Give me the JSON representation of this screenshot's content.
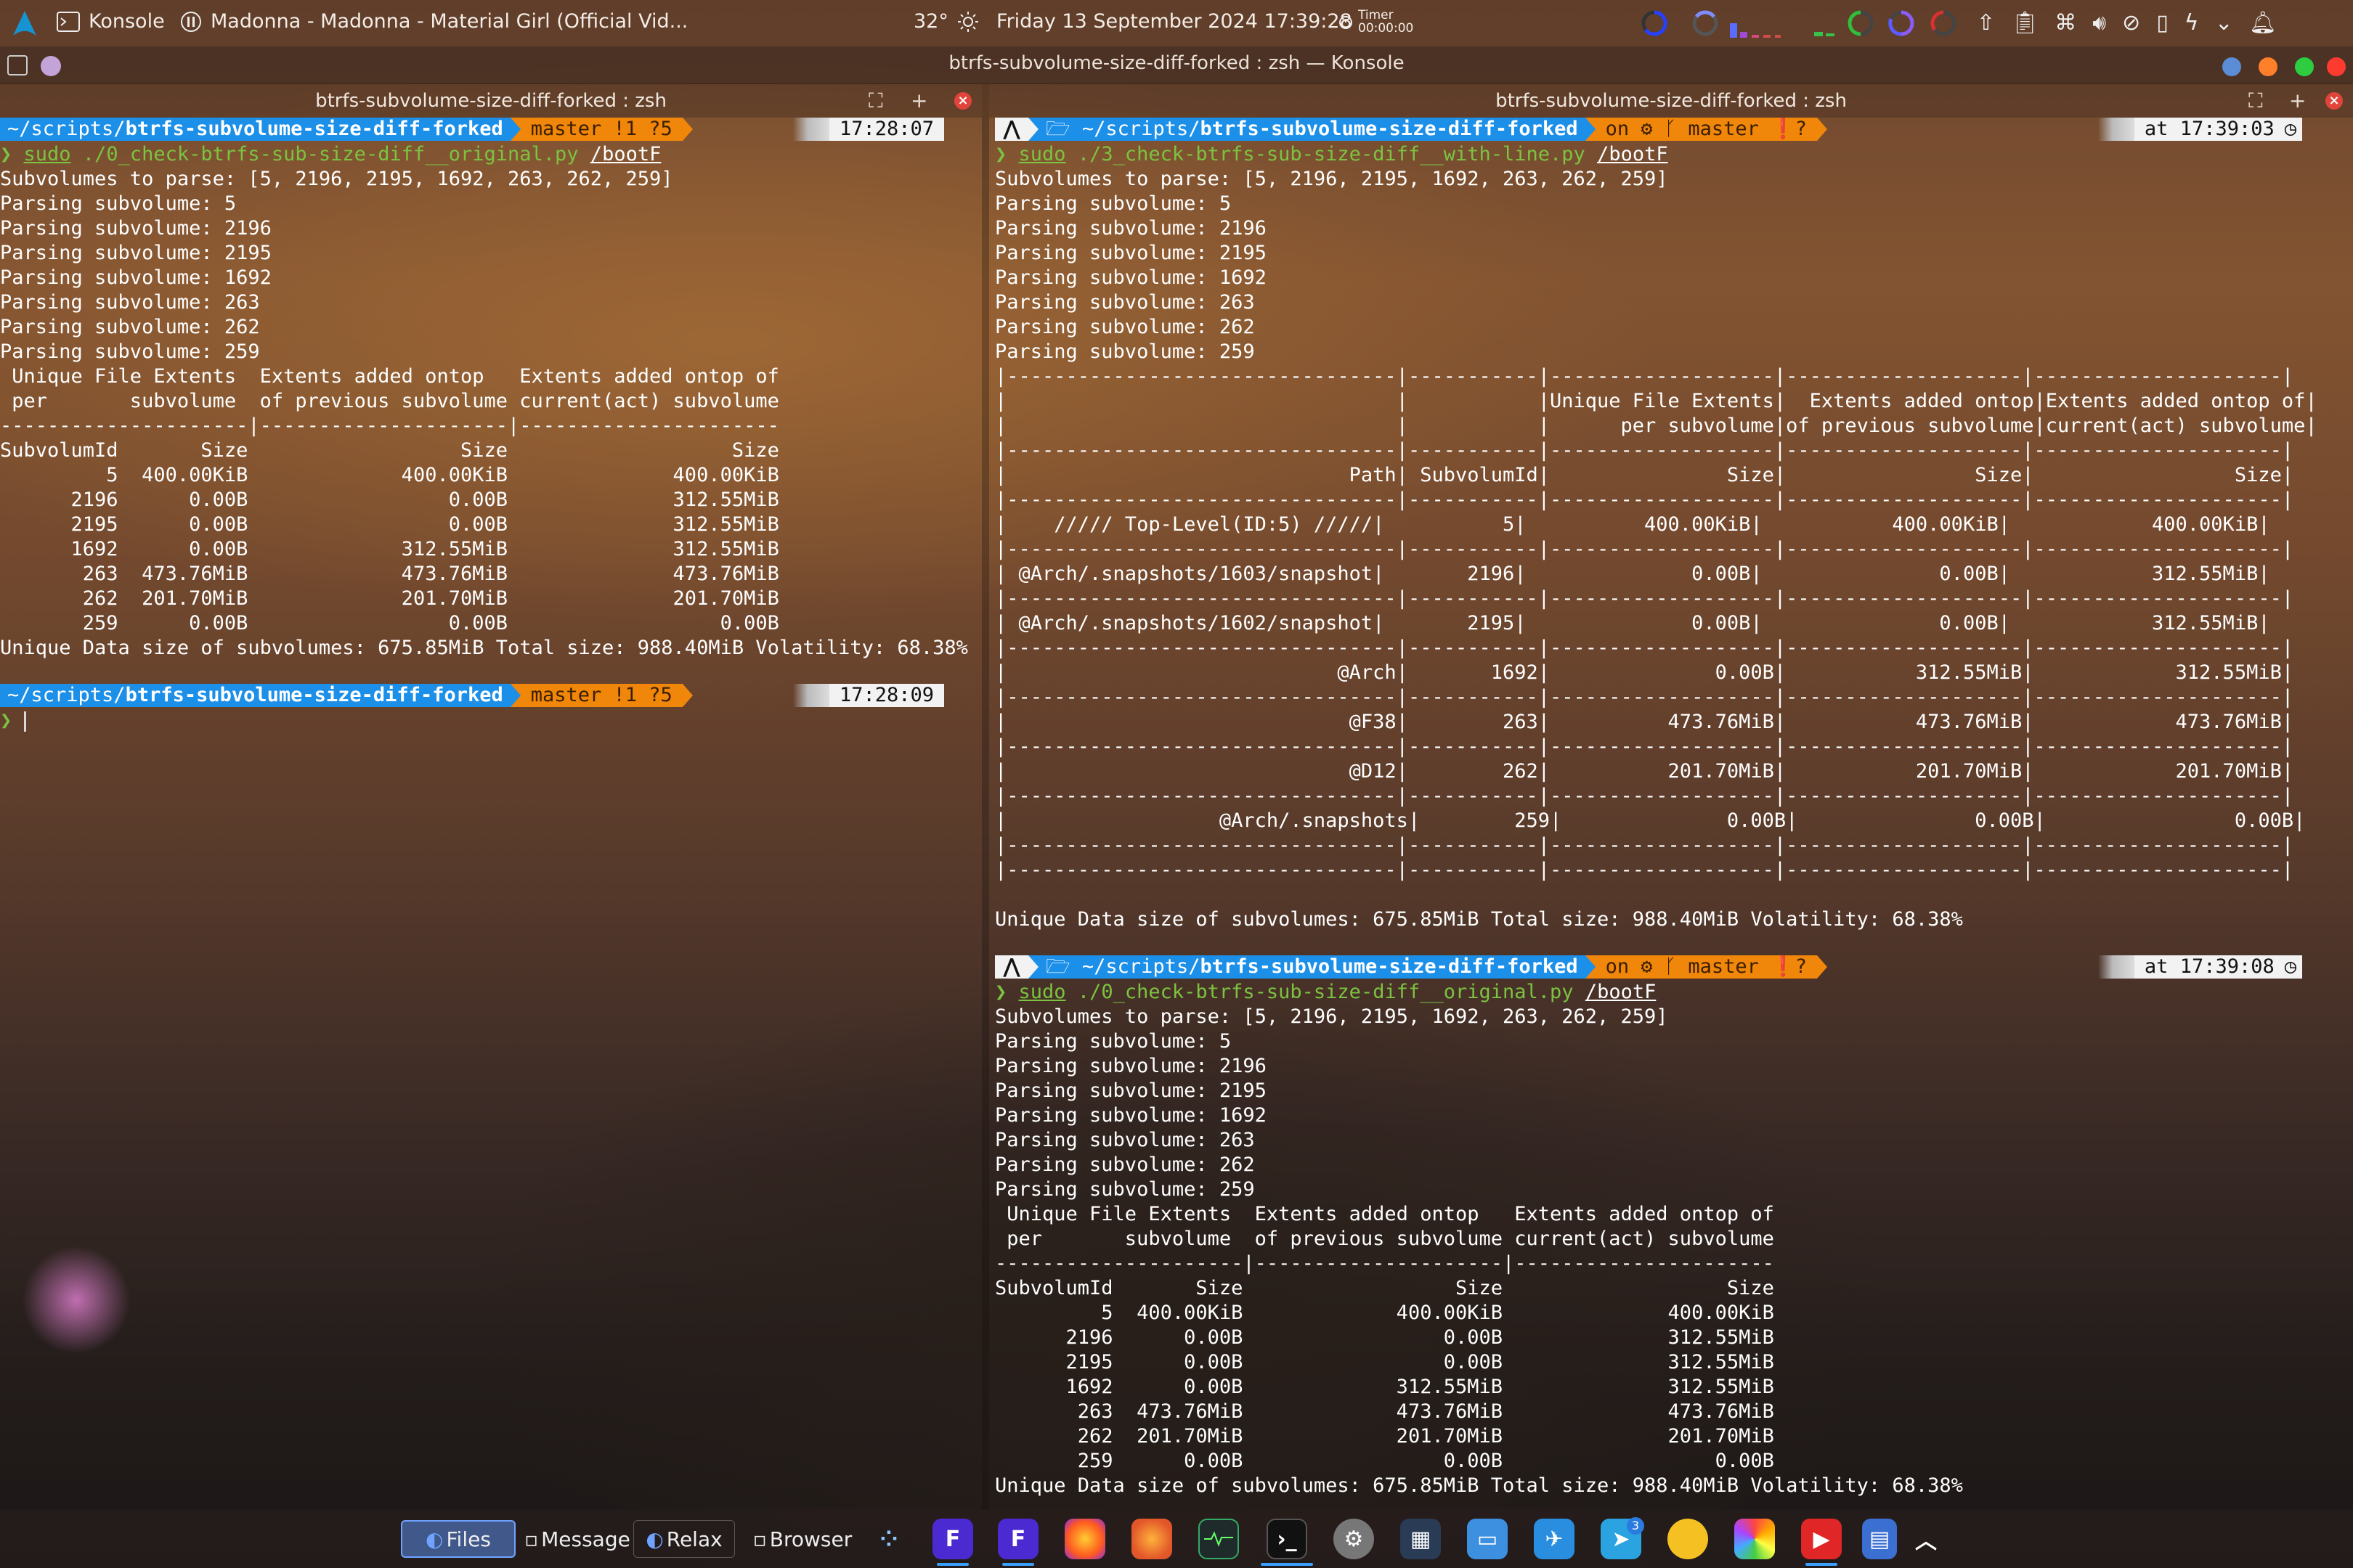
{
  "top_panel": {
    "app": "Konsole",
    "media": "Madonna - Madonna - Material Girl (Official Vid...",
    "temperature": "32°",
    "datetime": "Friday 13 September 2024 17:39:28",
    "timer_label": "Timer",
    "timer_value": "00:00:00"
  },
  "window": {
    "title": "btrfs-subvolume-size-diff-forked : zsh — Konsole",
    "colors": {
      "blue": "#5b8dd6",
      "orange": "#ff7f2a",
      "green": "#2ecc40",
      "red": "#ff3b30"
    }
  },
  "left_pane": {
    "tab_title": "btrfs-subvolume-size-diff-forked : zsh",
    "prompt1": {
      "path_prefix": "~/scripts/",
      "path_bold": "btrfs-subvolume-size-diff-forked",
      "git": "master !1 ?5",
      "time": "17:28:07"
    },
    "command": {
      "sudo": "sudo",
      "script": "./0_check-btrfs-sub-size-diff__original.py",
      "arg": "/bootF"
    },
    "output": [
      "Subvolumes to parse: [5, 2196, 2195, 1692, 263, 262, 259]",
      "Parsing subvolume: 5",
      "Parsing subvolume: 2196",
      "Parsing subvolume: 2195",
      "Parsing subvolume: 1692",
      "Parsing subvolume: 263",
      "Parsing subvolume: 262",
      "Parsing subvolume: 259",
      " Unique File Extents  Extents added ontop   Extents added ontop of",
      " per       subvolume  of previous subvolume current(act) subvolume",
      "---------------------|---------------------|----------------------",
      "SubvolumId       Size                  Size                   Size",
      "         5  400.00KiB             400.00KiB              400.00KiB",
      "      2196      0.00B                 0.00B              312.55MiB",
      "      2195      0.00B                 0.00B              312.55MiB",
      "      1692      0.00B             312.55MiB              312.55MiB",
      "       263  473.76MiB             473.76MiB              473.76MiB",
      "       262  201.70MiB             201.70MiB              201.70MiB",
      "       259      0.00B                 0.00B                  0.00B",
      "Unique Data size of subvolumes: 675.85MiB Total size: 988.40MiB Volatility: 68.38%"
    ],
    "prompt2": {
      "path_prefix": "~/scripts/",
      "path_bold": "btrfs-subvolume-size-diff-forked",
      "git": "master !1 ?5",
      "time": "17:28:09"
    },
    "cursor_prompt": "❯"
  },
  "right_pane": {
    "tab_title": "btrfs-subvolume-size-diff-forked : zsh",
    "prompt1": {
      "arch_icon": "⋀",
      "path_prefix": "~/scripts/",
      "path_bold": "btrfs-subvolume-size-diff-forked",
      "git": "on ⚙ ᚴ master ❗?",
      "time": "at 17:39:03"
    },
    "command1": {
      "sudo": "sudo",
      "script": "./3_check-btrfs-sub-size-diff__with-line.py",
      "arg": "/bootF"
    },
    "output1": [
      "Subvolumes to parse: [5, 2196, 2195, 1692, 263, 262, 259]",
      "Parsing subvolume: 5",
      "Parsing subvolume: 2196",
      "Parsing subvolume: 2195",
      "Parsing subvolume: 1692",
      "Parsing subvolume: 263",
      "Parsing subvolume: 262",
      "Parsing subvolume: 259",
      "|---------------------------------|-----------|-------------------|--------------------|---------------------|",
      "|                                 |           |Unique File Extents|  Extents added ontop|Extents added ontop of|",
      "|                                 |           |      per subvolume|of previous subvolume|current(act) subvolume|",
      "|---------------------------------|-----------|-------------------|--------------------|---------------------|",
      "|                             Path| SubvolumId|               Size|                Size|                 Size|",
      "|---------------------------------|-----------|-------------------|--------------------|---------------------|",
      "|    ///// Top-Level(ID:5) /////|          5|          400.00KiB|           400.00KiB|            400.00KiB|",
      "|---------------------------------|-----------|-------------------|--------------------|---------------------|",
      "| @Arch/.snapshots/1603/snapshot|       2196|              0.00B|               0.00B|            312.55MiB|",
      "|---------------------------------|-----------|-------------------|--------------------|---------------------|",
      "| @Arch/.snapshots/1602/snapshot|       2195|              0.00B|               0.00B|            312.55MiB|",
      "|---------------------------------|-----------|-------------------|--------------------|---------------------|",
      "|                            @Arch|       1692|              0.00B|           312.55MiB|            312.55MiB|",
      "|---------------------------------|-----------|-------------------|--------------------|---------------------|",
      "|                             @F38|        263|          473.76MiB|           473.76MiB|            473.76MiB|",
      "|---------------------------------|-----------|-------------------|--------------------|---------------------|",
      "|                             @D12|        262|          201.70MiB|           201.70MiB|            201.70MiB|",
      "|---------------------------------|-----------|-------------------|--------------------|---------------------|",
      "|                  @Arch/.snapshots|        259|              0.00B|               0.00B|                0.00B|",
      "|---------------------------------|-----------|-------------------|--------------------|---------------------|",
      "|---------------------------------|-----------|-------------------|--------------------|---------------------|",
      "",
      "Unique Data size of subvolumes: 675.85MiB Total size: 988.40MiB Volatility: 68.38%"
    ],
    "prompt2": {
      "arch_icon": "⋀",
      "path_prefix": "~/scripts/",
      "path_bold": "btrfs-subvolume-size-diff-forked",
      "git": "on ⚙ ᚴ master ❗?",
      "time": "at 17:39:08"
    },
    "command2": {
      "sudo": "sudo",
      "script": "./0_check-btrfs-sub-size-diff__original.py",
      "arg": "/bootF"
    },
    "output2": [
      "Subvolumes to parse: [5, 2196, 2195, 1692, 263, 262, 259]",
      "Parsing subvolume: 5",
      "Parsing subvolume: 2196",
      "Parsing subvolume: 2195",
      "Parsing subvolume: 1692",
      "Parsing subvolume: 263",
      "Parsing subvolume: 262",
      "Parsing subvolume: 259",
      " Unique File Extents  Extents added ontop   Extents added ontop of",
      " per       subvolume  of previous subvolume current(act) subvolume",
      "---------------------|---------------------|----------------------",
      "SubvolumId       Size                  Size                   Size",
      "         5  400.00KiB             400.00KiB              400.00KiB",
      "      2196      0.00B                 0.00B              312.55MiB",
      "      2195      0.00B                 0.00B              312.55MiB",
      "      1692      0.00B             312.55MiB              312.55MiB",
      "       263  473.76MiB             473.76MiB              473.76MiB",
      "       262  201.70MiB             201.70MiB              201.70MiB",
      "       259      0.00B                 0.00B                  0.00B",
      "Unique Data size of subvolumes: 675.85MiB Total size: 988.40MiB Volatility: 68.38%"
    ]
  },
  "taskbar": {
    "items": [
      {
        "label": "Files"
      },
      {
        "label": "Message"
      },
      {
        "label": "Relax"
      },
      {
        "label": "Browser"
      }
    ],
    "badge": "3",
    "icons": [
      "sparkle-icon",
      "fluent-app-1-icon",
      "fluent-app-2-icon",
      "firefox-icon",
      "firefox-dev-icon",
      "system-monitor-icon",
      "konsole-icon",
      "settings-icon",
      "calculator-icon",
      "dolphin-icon",
      "kdeconnect-icon",
      "telegram-icon",
      "notes-icon",
      "photos-icon",
      "youtube-icon",
      "calendar-icon",
      "expand-tray-icon"
    ]
  }
}
